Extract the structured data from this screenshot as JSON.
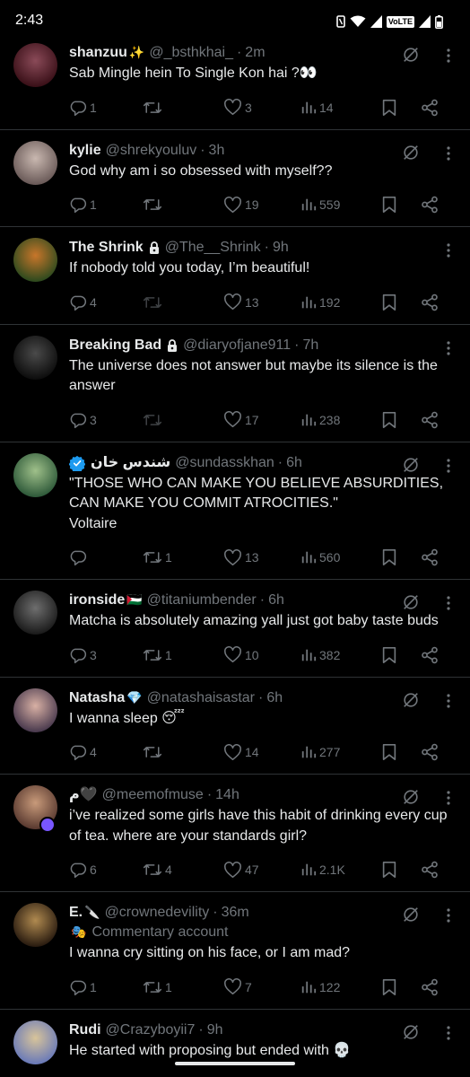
{
  "status_bar": {
    "time": "2:43",
    "network_label": "VoLTE"
  },
  "tweets": [
    {
      "name": "shanzuu",
      "name_emoji": "✨",
      "handle": "@_bsthkhai_",
      "time": "2m",
      "text": "Sab Mingle hein To Single Kon hai ?👀",
      "replies": "1",
      "retweets": "",
      "likes": "3",
      "views": "14",
      "avatar_colors": [
        "#3a1018",
        "#8a4a58"
      ],
      "retweet_disabled": false
    },
    {
      "name": "kylie",
      "handle": "@shrekyouluv",
      "time": "3h",
      "text": "God why am i so obsessed with myself??",
      "replies": "1",
      "retweets": "",
      "likes": "19",
      "views": "559",
      "avatar_colors": [
        "#6a5a58",
        "#c9b8b0"
      ],
      "retweet_disabled": false
    },
    {
      "name": "The Shrink",
      "protected": true,
      "handle": "@The__Shrink",
      "time": "9h",
      "text": "If nobody told you today, I’m beautiful!",
      "replies": "4",
      "retweets": "",
      "likes": "13",
      "views": "192",
      "avatar_colors": [
        "#2e4a1e",
        "#c8762a"
      ],
      "retweet_disabled": true
    },
    {
      "name": "Breaking Bad",
      "protected": true,
      "handle": "@diaryofjane911",
      "time": "7h",
      "text": "The universe does not answer but maybe its silence is the answer",
      "replies": "3",
      "retweets": "",
      "likes": "17",
      "views": "238",
      "avatar_colors": [
        "#0d0d0d",
        "#4a4a4a"
      ],
      "retweet_disabled": true
    },
    {
      "name": "شندس خان",
      "verified": true,
      "handle": "@sundasskhan",
      "time": "6h",
      "text": "\"THOSE WHO CAN MAKE YOU BELIEVE ABSURDITIES, CAN MAKE YOU COMMIT ATROCITIES.\"\nVoltaire",
      "replies": "",
      "retweets": "1",
      "likes": "13",
      "views": "560",
      "avatar_colors": [
        "#2f5a3a",
        "#9fc08a"
      ],
      "retweet_disabled": false
    },
    {
      "name": "ironside",
      "name_emoji": "🇵🇸",
      "handle": "@titaniumbender",
      "time": "6h",
      "text": "Matcha is absolutely amazing yall just got baby taste buds",
      "replies": "3",
      "retweets": "1",
      "likes": "10",
      "views": "382",
      "avatar_colors": [
        "#1b1b1b",
        "#6e6e6e"
      ],
      "retweet_disabled": false
    },
    {
      "name": "Natasha",
      "name_emoji": "💎",
      "handle": "@natashaisastar",
      "time": "6h",
      "text": "I wanna sleep 😴",
      "replies": "4",
      "retweets": "",
      "likes": "14",
      "views": "277",
      "avatar_colors": [
        "#4a3a4e",
        "#d8b0a4"
      ],
      "retweet_disabled": false
    },
    {
      "name": "م🖤",
      "handle": "@meemofmuse",
      "time": "14h",
      "text": "i’ve realized some girls have this habit of drinking every cup of tea. where are your standards girl?",
      "replies": "6",
      "retweets": "4",
      "likes": "47",
      "views": "2.1K",
      "avatar_colors": [
        "#5a3a30",
        "#c89a7a"
      ],
      "retweet_disabled": false,
      "avatar_badge": true
    },
    {
      "name": "E.",
      "name_emoji": "🔪",
      "handle": "@crownedevility",
      "time": "36m",
      "sub_label": "Commentary account",
      "sub_emoji": "🎭",
      "text": "I wanna cry sitting on his face, or I am mad?",
      "replies": "1",
      "retweets": "1",
      "likes": "7",
      "views": "122",
      "avatar_colors": [
        "#2a1c10",
        "#b08a50"
      ],
      "retweet_disabled": false
    },
    {
      "name": "Rudi",
      "handle": "@Crazyboyii7",
      "time": "9h",
      "text": "He started with proposing but ended with 💀",
      "avatar_colors": [
        "#6a7ab8",
        "#d8c49a"
      ],
      "partial": true
    }
  ]
}
